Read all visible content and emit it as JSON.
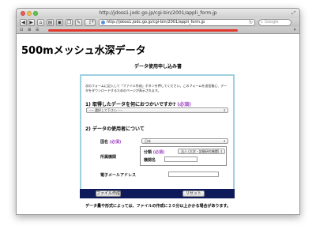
{
  "browser": {
    "window_title": "http://jdoss1.jodc.go.jp/cgi-bin/2001/appli_form.jp",
    "url": "http://jdoss1.jodc.go.jp/cgi-bin/2001/appli_form.jp",
    "search_placeholder": "Google",
    "nav": {
      "back": "◀",
      "forward": "▶",
      "add": "+"
    }
  },
  "page": {
    "title": "500mメッシュ水深データ",
    "form_heading": "データ使用申し込み書",
    "intro": "次のフォームに記入して「ファイル作成」ボタンを押してください。このフォームを送信後に、データをダウンロードするためのページが表示されます。",
    "q1": {
      "label": "1) 取得したデータを何におつかいですか?",
      "required": "(必須)",
      "select_value": "---- 選択して下さい ----"
    },
    "q2": {
      "label": "2) データの使用者について"
    },
    "country": {
      "label": "国名",
      "required": "(必須)",
      "value": "日本"
    },
    "organization": {
      "label": "所属機関",
      "class_label": "分類",
      "required": "(必須)",
      "class_value": "法人 (大学・試験研究機関)",
      "name_label": "機関名",
      "name_value": ""
    },
    "email": {
      "label": "電子メールアドレス",
      "value": ""
    },
    "buttons": {
      "create": "ファイル作成",
      "reset": "リセット"
    },
    "note": "データ量や形式によっては、ファイルの作成に２０分以上かかる場合があります。"
  }
}
